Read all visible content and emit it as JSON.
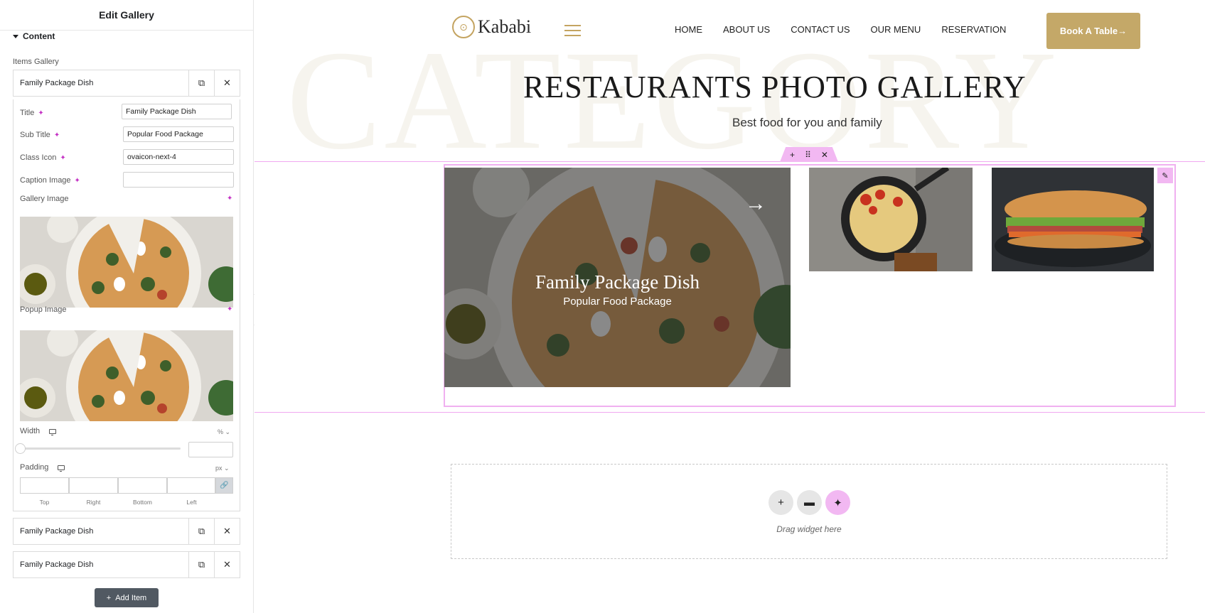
{
  "panel": {
    "title": "Edit Gallery",
    "section": "Content",
    "items_label": "Items Gallery",
    "items": [
      {
        "label": "Family Package Dish"
      },
      {
        "label": "Family Package Dish"
      },
      {
        "label": "Family Package Dish"
      }
    ],
    "fields": {
      "title": {
        "label": "Title",
        "value": "Family Package Dish"
      },
      "subtitle": {
        "label": "Sub Title",
        "value": "Popular Food Package"
      },
      "class_icon": {
        "label": "Class Icon",
        "value": "ovaicon-next-4"
      },
      "caption_image": {
        "label": "Caption Image",
        "value": ""
      },
      "gallery_image": {
        "label": "Gallery Image"
      },
      "popup_image": {
        "label": "Popup Image"
      },
      "width": {
        "label": "Width",
        "unit": "%",
        "value": ""
      },
      "padding": {
        "label": "Padding",
        "unit": "px",
        "sides": [
          "Top",
          "Right",
          "Bottom",
          "Left"
        ]
      }
    },
    "add_item": "Add Item"
  },
  "site": {
    "logo_text": "Kababi",
    "nav": [
      "HOME",
      "ABOUT US",
      "CONTACT US",
      "OUR MENU",
      "RESERVATION"
    ],
    "book_button": "Book A Table",
    "background_word": "CATEGORY",
    "gallery_title": "RESTAURANTS PHOTO GALLERY",
    "gallery_subtitle": "Best food for you and family",
    "featured": {
      "title": "Family Package Dish",
      "subtitle": "Popular Food Package"
    },
    "drop_text": "Drag widget here"
  },
  "colors": {
    "accent_gold": "#c4a868",
    "editor_pink": "#f2b8f2",
    "ai_magenta": "#c432c4"
  },
  "icons": {
    "duplicate": "duplicate-icon",
    "remove": "close-icon",
    "ai": "sparkle-icon",
    "responsive": "desktop-icon",
    "link": "link-icon",
    "arrow": "arrow-right-icon"
  }
}
